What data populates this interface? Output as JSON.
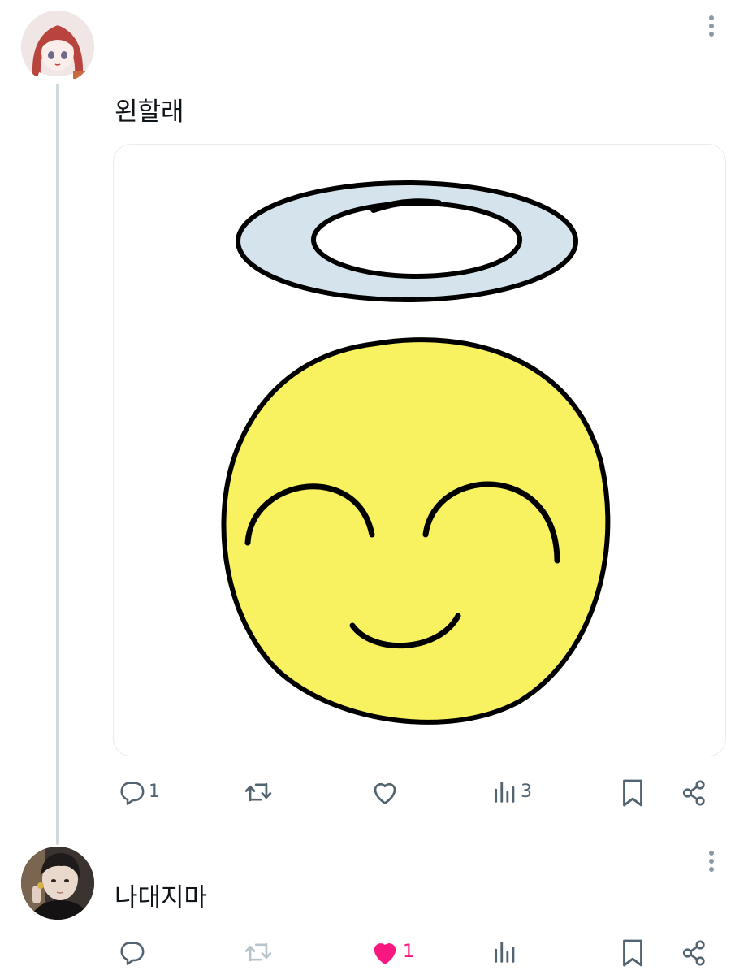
{
  "posts": [
    {
      "text": "왼할래",
      "avatar": "red-haired-anime-avatar",
      "actions": {
        "replies": "1",
        "reposts": "",
        "likes": "",
        "views": "3"
      }
    },
    {
      "text": "나대지마",
      "avatar": "person-photo-avatar",
      "actions": {
        "replies": "",
        "reposts": "",
        "likes": "1",
        "views": ""
      },
      "liked": true
    }
  ],
  "icons": {
    "reply": "reply-icon",
    "repost": "repost-icon",
    "like": "heart-icon",
    "views": "views-icon",
    "bookmark": "bookmark-icon",
    "share": "share-icon",
    "more": "more-vertical-icon"
  },
  "colors": {
    "icon_gray": "#536471",
    "repost_disabled": "#b8c4cc",
    "like_active": "#f91880",
    "thread_line": "#cfd9de",
    "halo_fill": "#d5e4ec",
    "face_fill": "#f8f160"
  }
}
